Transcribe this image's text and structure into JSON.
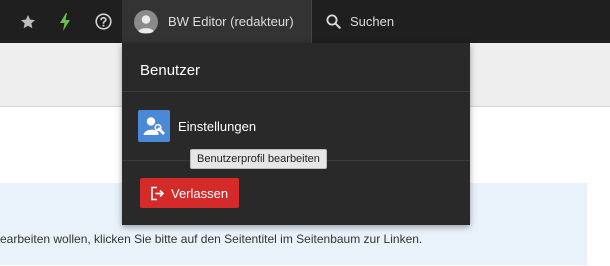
{
  "toolbar": {
    "bookmark_icon": "star-icon",
    "cache_icon": "bolt-icon",
    "help_icon": "help-icon",
    "user_label": "BW Editor (redakteur)",
    "search_label": "Suchen",
    "colors": {
      "bar": "#1f1f1f",
      "active": "#333333",
      "bolt": "#6cc04a"
    }
  },
  "user_menu": {
    "header": "Benutzer",
    "items": [
      {
        "label": "Einstellungen",
        "icon": "user-settings-icon",
        "tooltip": "Benutzerprofil bearbeiten"
      }
    ],
    "logout_label": "Verlassen",
    "colors": {
      "panel": "#292929",
      "settings_icon_bg": "#4a89d6",
      "logout_bg": "#d52a2a"
    }
  },
  "content": {
    "info_text": "earbeiten wollen, klicken Sie bitte auf den Seitentitel im Seitenbaum zur Linken.",
    "info_bg": "#e9f1fb"
  }
}
